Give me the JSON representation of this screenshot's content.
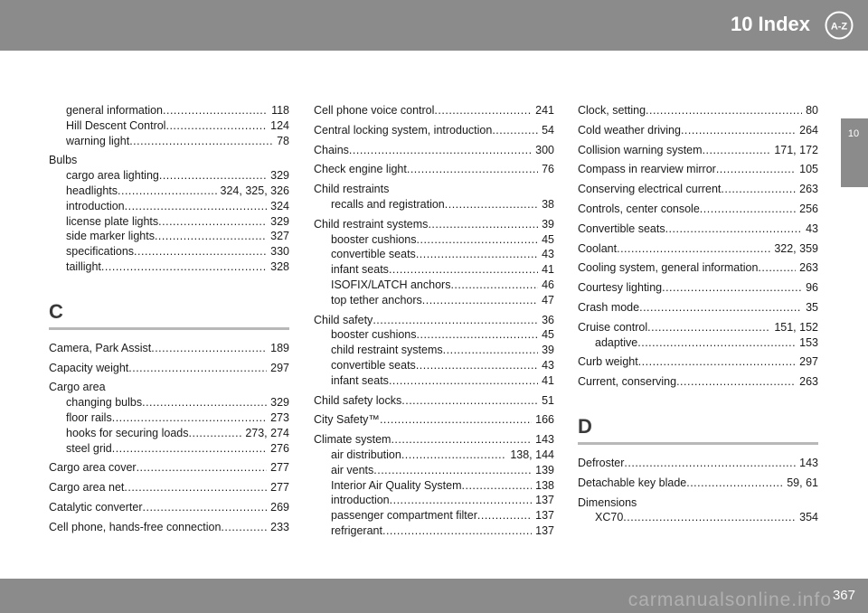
{
  "header": {
    "title": "10 Index",
    "icon": "A-Z"
  },
  "side_tab": {
    "label": "10"
  },
  "footer": {
    "page_number": "367",
    "watermark": "carmanualsonline.info"
  },
  "columns": [
    [
      {
        "type": "entry",
        "level": 1,
        "text": "general information",
        "pages": "118"
      },
      {
        "type": "entry",
        "level": 1,
        "text": "Hill Descent Control",
        "pages": "124"
      },
      {
        "type": "entry",
        "level": 1,
        "text": "warning light",
        "pages": "78"
      },
      {
        "type": "entry",
        "level": 0,
        "text": "Bulbs",
        "pages": ""
      },
      {
        "type": "entry",
        "level": 1,
        "text": "cargo area lighting",
        "pages": "329"
      },
      {
        "type": "entry",
        "level": 1,
        "text": "headlights",
        "pages": "324, 325, 326"
      },
      {
        "type": "entry",
        "level": 1,
        "text": "introduction",
        "pages": "324"
      },
      {
        "type": "entry",
        "level": 1,
        "text": "license plate lights",
        "pages": "329"
      },
      {
        "type": "entry",
        "level": 1,
        "text": "side marker lights",
        "pages": "327"
      },
      {
        "type": "entry",
        "level": 1,
        "text": "specifications",
        "pages": "330"
      },
      {
        "type": "entry",
        "level": 1,
        "text": "taillight",
        "pages": "328"
      },
      {
        "type": "section",
        "letter": "C"
      },
      {
        "type": "entry",
        "level": 0,
        "text": "Camera, Park Assist",
        "pages": "189"
      },
      {
        "type": "entry",
        "level": 0,
        "text": "Capacity weight",
        "pages": "297"
      },
      {
        "type": "entry",
        "level": 0,
        "text": "Cargo area",
        "pages": ""
      },
      {
        "type": "entry",
        "level": 1,
        "text": "changing bulbs",
        "pages": "329"
      },
      {
        "type": "entry",
        "level": 1,
        "text": "floor rails",
        "pages": "273"
      },
      {
        "type": "entry",
        "level": 1,
        "text": "hooks for securing loads",
        "pages": "273, 274"
      },
      {
        "type": "entry",
        "level": 1,
        "text": "steel grid",
        "pages": "276"
      },
      {
        "type": "entry",
        "level": 0,
        "text": "Cargo area cover",
        "pages": "277"
      },
      {
        "type": "entry",
        "level": 0,
        "text": "Cargo area net",
        "pages": "277"
      },
      {
        "type": "entry",
        "level": 0,
        "text": "Catalytic converter",
        "pages": "269"
      },
      {
        "type": "entry",
        "level": 0,
        "text": "Cell phone, hands-free connection",
        "pages": "233"
      }
    ],
    [
      {
        "type": "entry",
        "level": 0,
        "text": "Cell phone voice control",
        "pages": "241"
      },
      {
        "type": "entry",
        "level": 0,
        "text": "Central locking system, introduction",
        "pages": "54"
      },
      {
        "type": "entry",
        "level": 0,
        "text": "Chains",
        "pages": "300"
      },
      {
        "type": "entry",
        "level": 0,
        "text": "Check engine light",
        "pages": "76"
      },
      {
        "type": "entry",
        "level": 0,
        "text": "Child restraints",
        "pages": ""
      },
      {
        "type": "entry",
        "level": 1,
        "text": "recalls and registration",
        "pages": "38"
      },
      {
        "type": "entry",
        "level": 0,
        "text": "Child restraint systems",
        "pages": "39"
      },
      {
        "type": "entry",
        "level": 1,
        "text": "booster cushions",
        "pages": "45"
      },
      {
        "type": "entry",
        "level": 1,
        "text": "convertible seats",
        "pages": "43"
      },
      {
        "type": "entry",
        "level": 1,
        "text": "infant seats",
        "pages": "41"
      },
      {
        "type": "entry",
        "level": 1,
        "text": "ISOFIX/LATCH anchors",
        "pages": "46"
      },
      {
        "type": "entry",
        "level": 1,
        "text": "top tether anchors",
        "pages": "47"
      },
      {
        "type": "entry",
        "level": 0,
        "text": "Child safety",
        "pages": "36"
      },
      {
        "type": "entry",
        "level": 1,
        "text": "booster cushions",
        "pages": "45"
      },
      {
        "type": "entry",
        "level": 1,
        "text": "child restraint systems",
        "pages": "39"
      },
      {
        "type": "entry",
        "level": 1,
        "text": "convertible seats",
        "pages": "43"
      },
      {
        "type": "entry",
        "level": 1,
        "text": "infant seats",
        "pages": "41"
      },
      {
        "type": "entry",
        "level": 0,
        "text": "Child safety locks",
        "pages": "51"
      },
      {
        "type": "entry",
        "level": 0,
        "text": "City Safety™",
        "pages": "166"
      },
      {
        "type": "entry",
        "level": 0,
        "text": "Climate system",
        "pages": "143"
      },
      {
        "type": "entry",
        "level": 1,
        "text": "air distribution",
        "pages": "138, 144"
      },
      {
        "type": "entry",
        "level": 1,
        "text": "air vents",
        "pages": "139"
      },
      {
        "type": "entry",
        "level": 1,
        "text": "Interior Air Quality System",
        "pages": "138"
      },
      {
        "type": "entry",
        "level": 1,
        "text": "introduction",
        "pages": "137"
      },
      {
        "type": "entry",
        "level": 1,
        "text": "passenger compartment filter",
        "pages": "137"
      },
      {
        "type": "entry",
        "level": 1,
        "text": "refrigerant",
        "pages": "137"
      }
    ],
    [
      {
        "type": "entry",
        "level": 0,
        "text": "Clock, setting",
        "pages": "80"
      },
      {
        "type": "entry",
        "level": 0,
        "text": "Cold weather driving",
        "pages": "264"
      },
      {
        "type": "entry",
        "level": 0,
        "text": "Collision warning system",
        "pages": "171, 172"
      },
      {
        "type": "entry",
        "level": 0,
        "text": "Compass in rearview mirror",
        "pages": "105"
      },
      {
        "type": "entry",
        "level": 0,
        "text": "Conserving electrical current",
        "pages": "263"
      },
      {
        "type": "entry",
        "level": 0,
        "text": "Controls, center console",
        "pages": "256"
      },
      {
        "type": "entry",
        "level": 0,
        "text": "Convertible seats",
        "pages": "43"
      },
      {
        "type": "entry",
        "level": 0,
        "text": "Coolant",
        "pages": "322, 359"
      },
      {
        "type": "entry",
        "level": 0,
        "text": "Cooling system, general information",
        "pages": "263"
      },
      {
        "type": "entry",
        "level": 0,
        "text": "Courtesy lighting",
        "pages": "96"
      },
      {
        "type": "entry",
        "level": 0,
        "text": "Crash mode",
        "pages": "35"
      },
      {
        "type": "entry",
        "level": 0,
        "text": "Cruise control",
        "pages": "151, 152"
      },
      {
        "type": "entry",
        "level": 1,
        "text": "adaptive",
        "pages": "153"
      },
      {
        "type": "entry",
        "level": 0,
        "text": "Curb weight",
        "pages": "297"
      },
      {
        "type": "entry",
        "level": 0,
        "text": "Current, conserving",
        "pages": "263"
      },
      {
        "type": "section",
        "letter": "D"
      },
      {
        "type": "entry",
        "level": 0,
        "text": "Defroster",
        "pages": "143"
      },
      {
        "type": "entry",
        "level": 0,
        "text": "Detachable key blade",
        "pages": "59, 61"
      },
      {
        "type": "entry",
        "level": 0,
        "text": "Dimensions",
        "pages": ""
      },
      {
        "type": "entry",
        "level": 1,
        "text": "XC70",
        "pages": "354"
      }
    ]
  ]
}
